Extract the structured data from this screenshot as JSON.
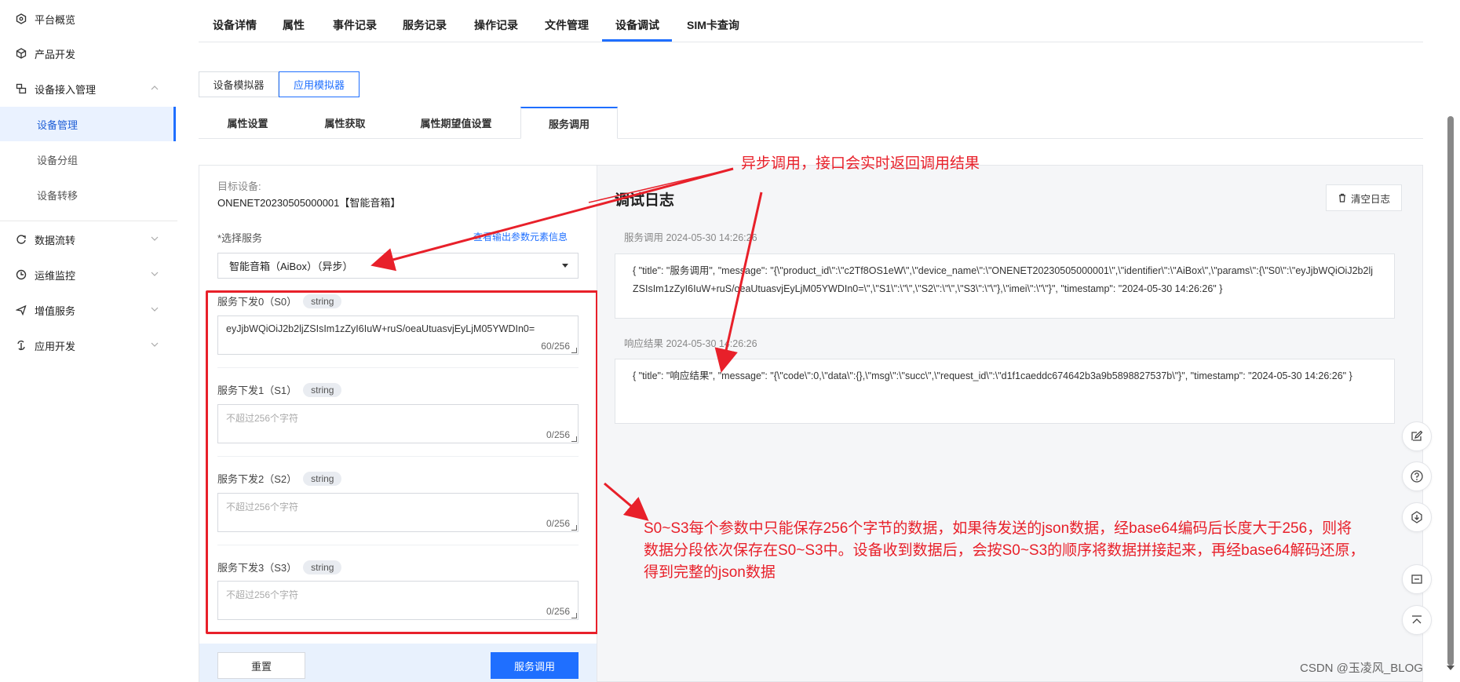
{
  "sidebar": {
    "items": [
      {
        "label": "平台概览",
        "icon": "hexagon-icon"
      },
      {
        "label": "产品开发",
        "icon": "cube-icon"
      },
      {
        "label": "设备接入管理",
        "icon": "device-icon"
      },
      {
        "label": "数据流转",
        "icon": "flow-icon"
      },
      {
        "label": "运维监控",
        "icon": "clock-icon"
      },
      {
        "label": "增值服务",
        "icon": "send-icon"
      },
      {
        "label": "应用开发",
        "icon": "app-icon"
      }
    ],
    "sub": [
      "设备管理",
      "设备分组",
      "设备转移"
    ]
  },
  "tabs": [
    "设备详情",
    "属性",
    "事件记录",
    "服务记录",
    "操作记录",
    "文件管理",
    "设备调试",
    "SIM卡查询"
  ],
  "modes": [
    "设备模拟器",
    "应用模拟器"
  ],
  "subtabs": [
    "属性设置",
    "属性获取",
    "属性期望值设置",
    "服务调用"
  ],
  "form": {
    "target_label": "目标设备:",
    "target_value": "ONENET20230505000001【智能音箱】",
    "service_label": "*选择服务",
    "service_link": "查看输出参数元素信息",
    "service_value": "智能音箱（AiBox）（异步）",
    "fields": [
      {
        "label": "服务下发0（S0）",
        "tag": "string",
        "value": "eyJjbWQiOiJ2b2ljZSIsIm1zZyI6IuW+ruS/oeaUtuasvjEyLjM05YWDIn0=",
        "placeholder": "",
        "count": "60/256"
      },
      {
        "label": "服务下发1（S1）",
        "tag": "string",
        "value": "",
        "placeholder": "不超过256个字符",
        "count": "0/256"
      },
      {
        "label": "服务下发2（S2）",
        "tag": "string",
        "value": "",
        "placeholder": "不超过256个字符",
        "count": "0/256"
      },
      {
        "label": "服务下发3（S3）",
        "tag": "string",
        "value": "",
        "placeholder": "不超过256个字符",
        "count": "0/256"
      }
    ],
    "reset_label": "重置",
    "submit_label": "服务调用"
  },
  "log": {
    "title": "调试日志",
    "clear_label": "清空日志",
    "entries": [
      {
        "meta": "服务调用 2024-05-30 14:26:26",
        "text": "{ \"title\": \"服务调用\", \"message\": \"{\\\"product_id\\\":\\\"c2Tf8OS1eW\\\",\\\"device_name\\\":\\\"ONENET20230505000001\\\",\\\"identifier\\\":\\\"AiBox\\\",\\\"params\\\":{\\\"S0\\\":\\\"eyJjbWQiOiJ2b2ljZSIsIm1zZyI6IuW+ruS/oeaUtuasvjEyLjM05YWDIn0=\\\",\\\"S1\\\":\\\"\\\",\\\"S2\\\":\\\"\\\",\\\"S3\\\":\\\"\\\"},\\\"imei\\\":\\\"\\\"}\", \"timestamp\": \"2024-05-30 14:26:26\" }"
      },
      {
        "meta": "响应结果 2024-05-30 14:26:26",
        "text": "{ \"title\": \"响应结果\", \"message\": \"{\\\"code\\\":0,\\\"data\\\":{},\\\"msg\\\":\\\"succ\\\",\\\"request_id\\\":\\\"d1f1caeddc674642b3a9b5898827537b\\\"}\", \"timestamp\": \"2024-05-30 14:26:26\" }"
      }
    ]
  },
  "annotations": {
    "async": "异步调用，接口会实时返回调用结果",
    "note": "S0~S3每个参数中只能保存256个字节的数据，如果待发送的json数据，经base64编码后长度大于256，则将数据分段依次保存在S0~S3中。设备收到数据后，会按S0~S3的顺序将数据拼接起来，再经base64解码还原，得到完整的json数据"
  },
  "watermark": "CSDN @玉凌风_BLOG",
  "colors": {
    "primary": "#1f6fff",
    "annotation": "#e8202a"
  }
}
